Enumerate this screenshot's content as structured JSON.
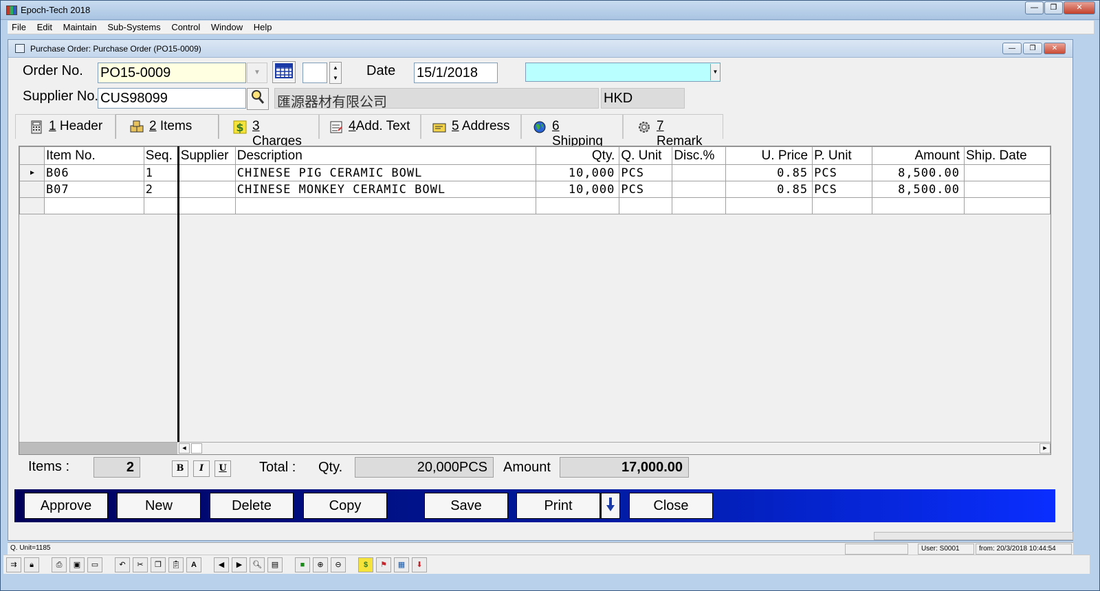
{
  "app": {
    "title": "Epoch-Tech 2018"
  },
  "menu": [
    {
      "label": "File"
    },
    {
      "label": "Edit"
    },
    {
      "label": "Maintain"
    },
    {
      "label": "Sub-Systems"
    },
    {
      "label": "Control"
    },
    {
      "label": "Window"
    },
    {
      "label": "Help"
    }
  ],
  "window": {
    "title": "Purchase Order: Purchase Order (PO15-0009)"
  },
  "form": {
    "order_no_label": "Order No.",
    "order_no": "PO15-0009",
    "date_label": "Date",
    "date": "15/1/2018",
    "supplier_no_label": "Supplier No.",
    "supplier_no": "CUS98099",
    "supplier_name": "匯源器材有限公司",
    "currency": "HKD"
  },
  "tabs": [
    {
      "num": "1",
      "label": "Header",
      "icon": "calculator-icon"
    },
    {
      "num": "2",
      "label": "Items",
      "icon": "boxes-icon"
    },
    {
      "num": "3",
      "label": "Charges",
      "icon": "dollar-icon"
    },
    {
      "num": "4",
      "label": "Add. Text",
      "icon": "notepad-icon"
    },
    {
      "num": "5",
      "label": "Address",
      "icon": "envelope-icon"
    },
    {
      "num": "6",
      "label": "Shipping",
      "icon": "globe-icon"
    },
    {
      "num": "7",
      "label": "Remark",
      "icon": "gear-icon"
    }
  ],
  "grid": {
    "columns": [
      "Item No.",
      "Seq.",
      "Supplier",
      "Description",
      "Qty.",
      "Q. Unit",
      "Disc.%",
      "U. Price",
      "P. Unit",
      "Amount",
      "Ship. Date"
    ],
    "rows": [
      {
        "item_no": "B06",
        "seq": "1",
        "supplier": "",
        "description": "CHINESE PIG CERAMIC BOWL",
        "qty": "10,000",
        "q_unit": "PCS",
        "disc": "",
        "u_price": "0.85",
        "p_unit": "PCS",
        "amount": "8,500.00",
        "ship_date": ""
      },
      {
        "item_no": "B07",
        "seq": "2",
        "supplier": "",
        "description": "CHINESE MONKEY CERAMIC BOWL",
        "qty": "10,000",
        "q_unit": "PCS",
        "disc": "",
        "u_price": "0.85",
        "p_unit": "PCS",
        "amount": "8,500.00",
        "ship_date": ""
      }
    ]
  },
  "totals": {
    "items_label": "Items :",
    "items_count": "2",
    "total_label": "Total :",
    "qty_label": "Qty.",
    "qty_value": "20,000PCS",
    "amount_label": "Amount",
    "amount_value": "17,000.00",
    "bold": "B",
    "italic": "I",
    "underline": "U"
  },
  "actions": {
    "approve": "Approve",
    "new": "New",
    "delete": "Delete",
    "copy": "Copy",
    "save": "Save",
    "print": "Print",
    "close": "Close"
  },
  "status": {
    "field_info": "Q. Unit=1185",
    "user": "User: S0001",
    "from": "from: 20/3/2018 10:44:54"
  }
}
